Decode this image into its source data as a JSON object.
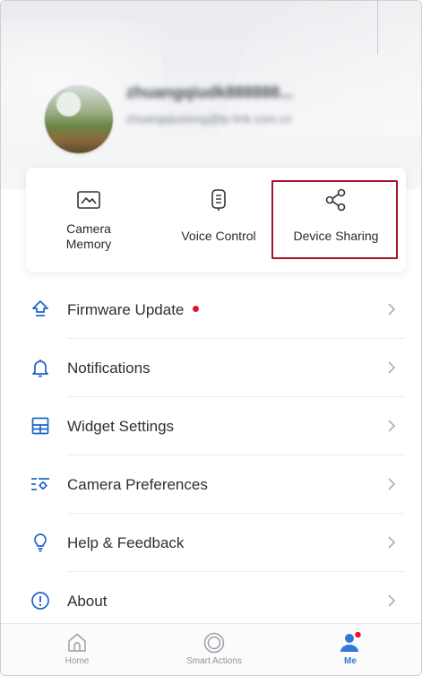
{
  "profile": {
    "name": "zhuangqiudk888888...",
    "email": "zhuangqiuxiong@tp-link.com.cn"
  },
  "quick_actions": [
    {
      "label": "Camera\nMemory",
      "icon": "camera-memory-icon"
    },
    {
      "label": "Voice Control",
      "icon": "voice-control-icon"
    },
    {
      "label": "Device Sharing",
      "icon": "share-icon"
    }
  ],
  "menu": {
    "items": [
      {
        "label": "Firmware Update",
        "icon": "firmware-update-icon",
        "has_dot": true
      },
      {
        "label": "Notifications",
        "icon": "bell-icon"
      },
      {
        "label": "Widget Settings",
        "icon": "widget-icon"
      },
      {
        "label": "Camera Preferences",
        "icon": "camera-preferences-icon"
      },
      {
        "label": "Help & Feedback",
        "icon": "lightbulb-icon"
      },
      {
        "label": "About",
        "icon": "info-icon"
      }
    ]
  },
  "bottom_nav": {
    "items": [
      {
        "label": "Home",
        "icon": "home-icon"
      },
      {
        "label": "Smart Actions",
        "icon": "smart-actions-icon"
      },
      {
        "label": "Me",
        "icon": "person-icon",
        "active": true
      }
    ]
  },
  "colors": {
    "accent": "#2f78d6",
    "icon_blue": "#1f64c8",
    "highlight": "#a8102e",
    "notification_dot": "#e8132a"
  }
}
